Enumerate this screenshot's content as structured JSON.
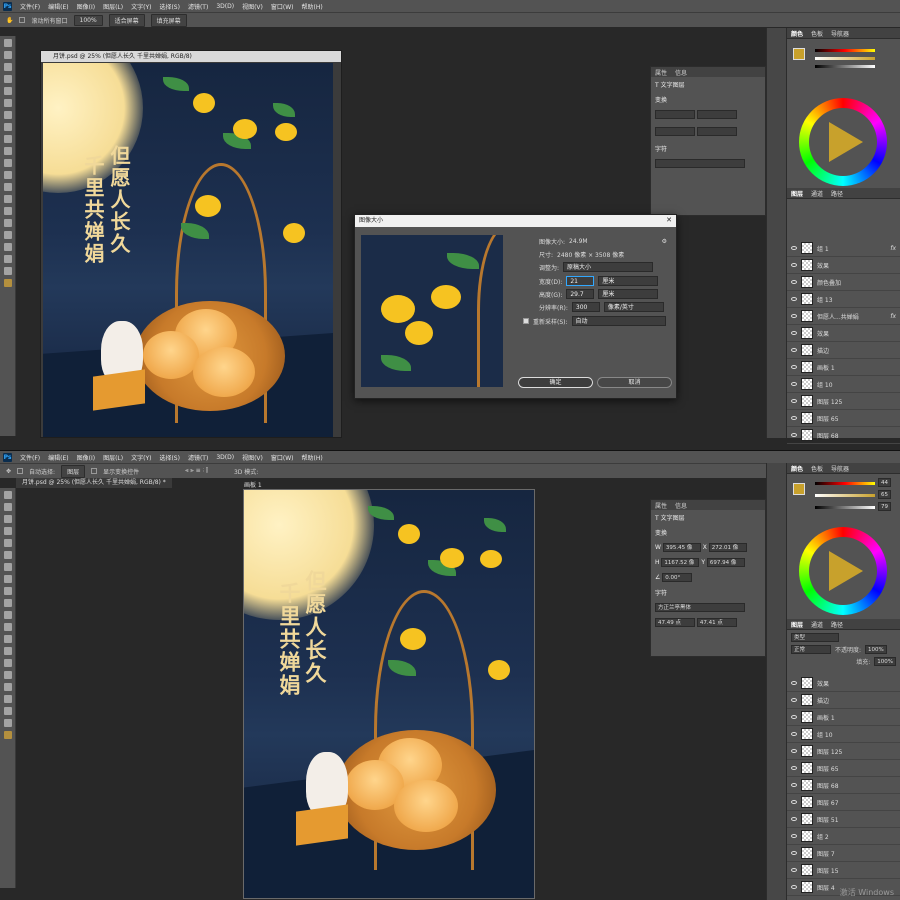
{
  "menu": {
    "logo": "Ps",
    "items": [
      "文件(F)",
      "编辑(E)",
      "图像(I)",
      "图层(L)",
      "文字(Y)",
      "选择(S)",
      "滤镜(T)",
      "3D(D)",
      "视图(V)",
      "窗口(W)",
      "帮助(H)"
    ]
  },
  "top": {
    "options": {
      "scroll_all": "滚动所有窗口",
      "zoom": "100%",
      "fit_screen": "适合屏幕",
      "fill_screen": "填充屏幕"
    },
    "doc_title": "月饼.psd @ 25% (但愿人长久 千里共婵娟, RGB/8)",
    "properties": {
      "tabs": [
        "属性",
        "信息"
      ],
      "type_label": "文字图层",
      "transform": "变换",
      "character": "字符"
    },
    "dialog": {
      "title": "图像大小",
      "image_size_label": "图像大小:",
      "image_size_value": "24.9M",
      "dimensions_label": "尺寸:",
      "dimensions_value": "2480 像素 × 3508 像素",
      "fit_label": "调整为:",
      "fit_value": "原稿大小",
      "width_label": "宽度(D):",
      "width_value": "21",
      "width_unit": "厘米",
      "height_label": "高度(G):",
      "height_value": "29.7",
      "height_unit": "厘米",
      "resolution_label": "分辨率(R):",
      "resolution_value": "300",
      "resolution_unit": "像素/英寸",
      "resample_label": "重新采样(S):",
      "resample_value": "自动",
      "ok": "确定",
      "cancel": "取消"
    },
    "layers": [
      {
        "name": "组 1",
        "meta": "fx"
      },
      {
        "name": "效果"
      },
      {
        "name": "颜色叠加"
      },
      {
        "name": "组 13"
      },
      {
        "name": "但愿人...共婵娟",
        "meta": "fx"
      },
      {
        "name": "效果"
      },
      {
        "name": "描边"
      },
      {
        "name": "画板 1"
      },
      {
        "name": "组 10"
      },
      {
        "name": "图层 125"
      },
      {
        "name": "图层 65"
      },
      {
        "name": "图层 68"
      }
    ]
  },
  "bottom": {
    "options": {
      "auto_select": "自动选择:",
      "select_target": "图层",
      "show_transform": "显示变换控件",
      "mode_3d": "3D 模式:"
    },
    "tab_title": "月饼.psd @ 25% (但愿人长久 千里共婵娟, RGB/8) *",
    "artboard_label": "画板 1",
    "properties": {
      "tabs": [
        "属性",
        "信息"
      ],
      "type_label": "文字图层",
      "transform": "变换",
      "w": "395.45 像",
      "x": "272.01 像",
      "h": "1167.52 像",
      "y": "697.94 像",
      "angle": "0.00°",
      "character": "字符",
      "font": "方正兰亭黑体",
      "size": "47.49 点",
      "leading": "47.41 点"
    },
    "color": {
      "tabs": [
        "颜色",
        "色板",
        "导航器"
      ],
      "h": "44",
      "s": "65",
      "b": "79"
    },
    "layers_tabs": [
      "图层",
      "通道",
      "路径"
    ],
    "layer_filter": "类型",
    "blend_mode": "正常",
    "opacity_label": "不透明度:",
    "opacity": "100%",
    "fill_label": "填充:",
    "fill": "100%",
    "layers": [
      {
        "name": "效果"
      },
      {
        "name": "描边"
      },
      {
        "name": "画板 1"
      },
      {
        "name": "组 10"
      },
      {
        "name": "图层 125"
      },
      {
        "name": "图层 65"
      },
      {
        "name": "图层 68"
      },
      {
        "name": "图层 67"
      },
      {
        "name": "图层 51"
      },
      {
        "name": "组 2"
      },
      {
        "name": "图层 7"
      },
      {
        "name": "图层 15"
      },
      {
        "name": "图层 4"
      }
    ],
    "watermark": "激活 Windows"
  },
  "artwork": {
    "line1": "但愿人长久",
    "line2": "千里共婵娟"
  },
  "accent": "#31a8ff"
}
